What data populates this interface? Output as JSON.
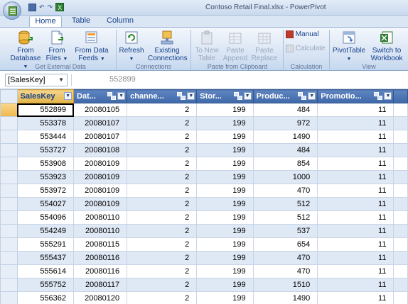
{
  "window": {
    "title": "Contoso Retail Final.xlsx  -  PowerPivot"
  },
  "quick_access": {
    "undo_label": "↶",
    "redo_label": "↷",
    "excel_label": "X"
  },
  "tabs": [
    {
      "label": "Home"
    },
    {
      "label": "Table"
    },
    {
      "label": "Column"
    }
  ],
  "ribbon": {
    "get_external_data": {
      "label": "Get External Data",
      "from_database": {
        "line1": "From",
        "line2": "Database"
      },
      "from_files": {
        "line1": "From",
        "line2": "Files"
      },
      "from_data_feeds": {
        "line1": "From Data",
        "line2": "Feeds"
      }
    },
    "connections": {
      "label": "Connections",
      "refresh": "Refresh",
      "existing": {
        "line1": "Existing",
        "line2": "Connections"
      }
    },
    "paste_from_clipboard": {
      "label": "Paste from Clipboard",
      "to_new_table": {
        "line1": "To New",
        "line2": "Table"
      },
      "paste_append": {
        "line1": "Paste",
        "line2": "Append"
      },
      "paste_replace": {
        "line1": "Paste",
        "line2": "Replace"
      }
    },
    "calculation": {
      "label": "Calculation",
      "manual": "Manual",
      "calculate": "Calculate"
    },
    "view": {
      "label": "View",
      "pivottable": "PivotTable",
      "switch": {
        "line1": "Switch to",
        "line2": "Workbook"
      }
    }
  },
  "formula_bar": {
    "name_box": "[SalesKey]",
    "value": "552899"
  },
  "grid": {
    "columns": [
      "SalesKey",
      "Dat...",
      "channe...",
      "Stor...",
      "Produc...",
      "Promotio..."
    ],
    "rows": [
      [
        "552899",
        "20080105",
        "2",
        "199",
        "484",
        "11"
      ],
      [
        "553378",
        "20080107",
        "2",
        "199",
        "972",
        "11"
      ],
      [
        "553444",
        "20080107",
        "2",
        "199",
        "1490",
        "11"
      ],
      [
        "553727",
        "20080108",
        "2",
        "199",
        "484",
        "11"
      ],
      [
        "553908",
        "20080109",
        "2",
        "199",
        "854",
        "11"
      ],
      [
        "553923",
        "20080109",
        "2",
        "199",
        "1000",
        "11"
      ],
      [
        "553972",
        "20080109",
        "2",
        "199",
        "470",
        "11"
      ],
      [
        "554027",
        "20080109",
        "2",
        "199",
        "512",
        "11"
      ],
      [
        "554096",
        "20080110",
        "2",
        "199",
        "512",
        "11"
      ],
      [
        "554249",
        "20080110",
        "2",
        "199",
        "537",
        "11"
      ],
      [
        "555291",
        "20080115",
        "2",
        "199",
        "654",
        "11"
      ],
      [
        "555437",
        "20080116",
        "2",
        "199",
        "470",
        "11"
      ],
      [
        "555614",
        "20080116",
        "2",
        "199",
        "470",
        "11"
      ],
      [
        "555752",
        "20080117",
        "2",
        "199",
        "1510",
        "11"
      ],
      [
        "556362",
        "20080120",
        "2",
        "199",
        "1490",
        "11"
      ]
    ]
  }
}
